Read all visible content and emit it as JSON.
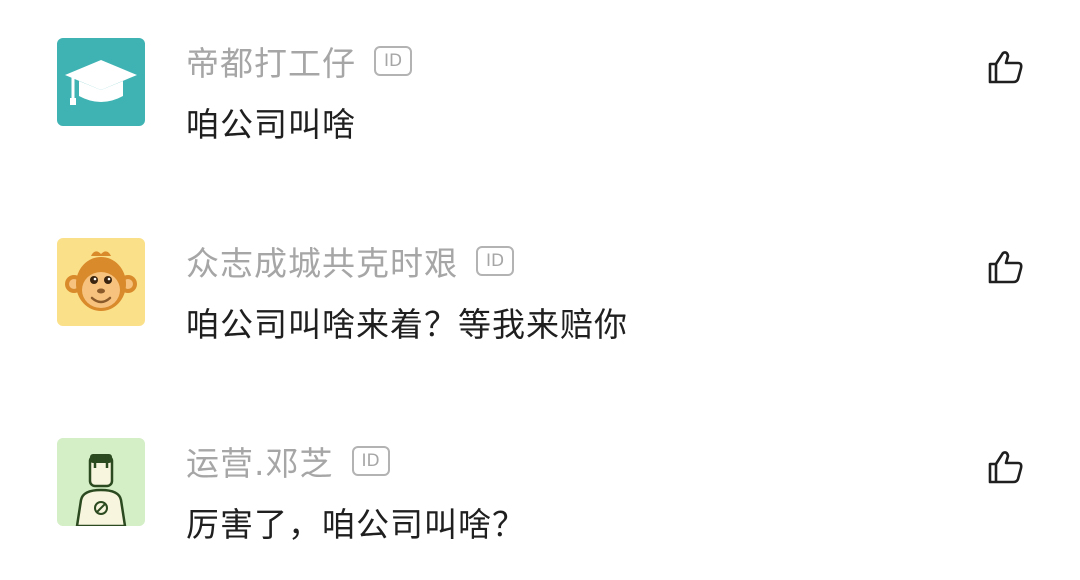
{
  "comments": [
    {
      "username": "帝都打工仔",
      "badge": "ID",
      "text": "咱公司叫啥",
      "avatar_icon": "graduation-cap-icon",
      "avatar_color": "#3fb3b3"
    },
    {
      "username": "众志成城共克时艰",
      "badge": "ID",
      "text": "咱公司叫啥来着？等我来赔你",
      "avatar_icon": "monkey-icon",
      "avatar_color": "#fbe08a"
    },
    {
      "username": "运营.邓芝",
      "badge": "ID",
      "text": "厉害了，咱公司叫啥？",
      "avatar_icon": "person-icon",
      "avatar_color": "#d4eec6"
    }
  ],
  "like_icon": "thumbs-up-icon"
}
